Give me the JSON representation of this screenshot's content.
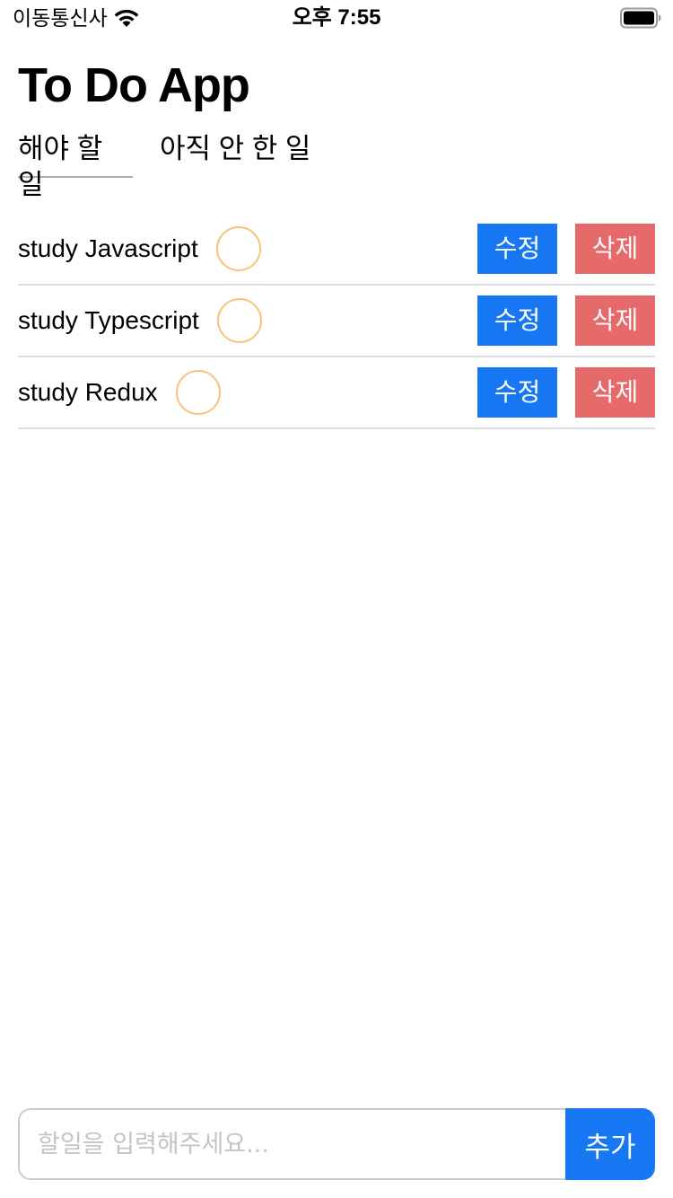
{
  "status_bar": {
    "carrier": "이동통신사",
    "time": "오후 7:55"
  },
  "header": {
    "title": "To Do App"
  },
  "tabs": [
    {
      "label": "해야 할 일",
      "selected": true
    },
    {
      "label": "아직 안 한 일",
      "selected": false
    }
  ],
  "todos": [
    {
      "text": "study Javascript",
      "edit_label": "수정",
      "delete_label": "삭제",
      "done": false
    },
    {
      "text": "study Typescript",
      "edit_label": "수정",
      "delete_label": "삭제",
      "done": false
    },
    {
      "text": "study Redux",
      "edit_label": "수정",
      "delete_label": "삭제",
      "done": false
    }
  ],
  "input": {
    "placeholder": "할일을 입력해주세요...",
    "value": "",
    "add_label": "추가"
  },
  "colors": {
    "accent": "#1877f2",
    "delete": "#e66a6a",
    "circle": "#f7c27a",
    "divider": "#dddddd"
  }
}
